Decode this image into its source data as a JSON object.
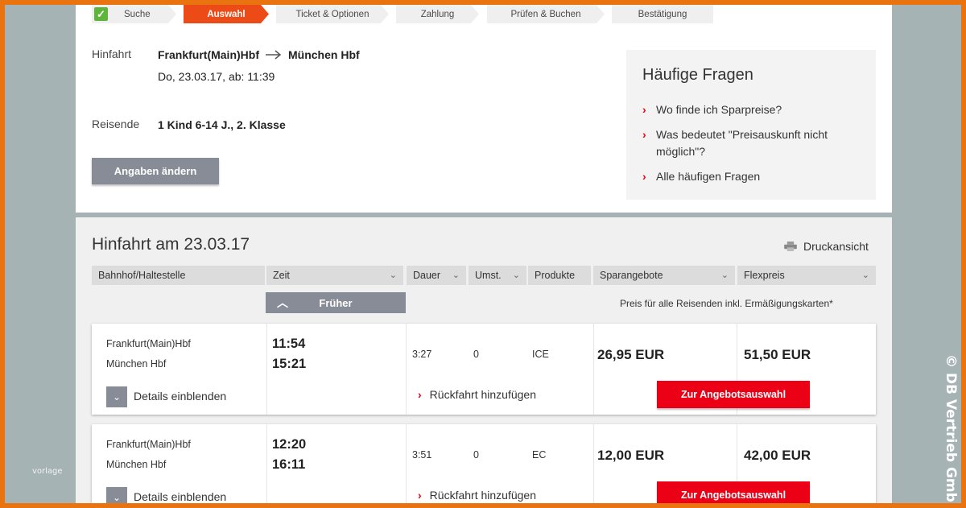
{
  "steps": [
    "Suche",
    "Auswahl",
    "Ticket & Optionen",
    "Zahlung",
    "Prüfen & Buchen",
    "Bestätigung"
  ],
  "trip": {
    "outbound_label": "Hinfahrt",
    "from": "Frankfurt(Main)Hbf",
    "to": "München Hbf",
    "date_time": "Do, 23.03.17, ab: 11:39",
    "travellers_label": "Reisende",
    "travellers": "1 Kind 6-14 J., 2. Klasse",
    "change_button": "Angaben ändern"
  },
  "faq": {
    "title": "Häufige Fragen",
    "items": [
      "Wo finde ich Sparpreise?",
      "Was bedeutet \"Preisauskunft nicht möglich\"?",
      "Alle häufigen Fragen"
    ]
  },
  "results": {
    "title": "Hinfahrt am 23.03.17",
    "print_label": "Druckansicht",
    "columns": [
      "Bahnhof/Haltestelle",
      "Zeit",
      "Dauer",
      "Umst.",
      "Produkte",
      "Sparangebote",
      "Flexpreis"
    ],
    "earlier_button": "Früher",
    "price_note": "Preis für alle Reisenden inkl. Ermäßigungskarten*",
    "connections": [
      {
        "from": "Frankfurt(Main)Hbf",
        "to": "München Hbf",
        "dep": "11:54",
        "arr": "15:21",
        "duration": "3:27",
        "changes": "0",
        "product": "ICE",
        "saver_price": "26,95 EUR",
        "flex_price": "51,50 EUR",
        "details_label": "Details einblenden",
        "return_label": "Rückfahrt hinzufügen",
        "offer_button": "Zur Angebotsauswahl"
      },
      {
        "from": "Frankfurt(Main)Hbf",
        "to": "München Hbf",
        "dep": "12:20",
        "arr": "16:11",
        "duration": "3:51",
        "changes": "0",
        "product": "EC",
        "saver_price": "12,00 EUR",
        "flex_price": "42,00 EUR",
        "details_label": "Details einblenden",
        "return_label": "Rückfahrt hinzufügen",
        "offer_button": "Zur Angebotsauswahl"
      }
    ]
  },
  "overlay": {
    "vorlage": "vorlage",
    "copyright": "© DB Vertrieb GmbH"
  },
  "colors": {
    "accent_red": "#ec0016",
    "active_step": "#ec4b18",
    "check_green": "#5fb53c",
    "grey_button": "#878c96",
    "frame_orange": "#e8730f"
  },
  "icons": [
    "check-icon",
    "arrow-right-icon",
    "chevron-right-icon",
    "printer-icon",
    "chevron-down-icon",
    "chevron-up-icon"
  ]
}
